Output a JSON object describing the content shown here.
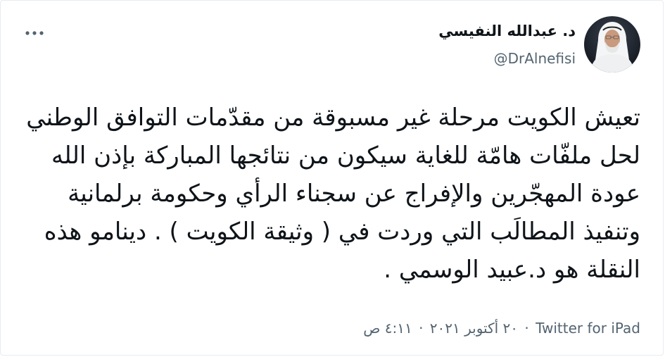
{
  "author": {
    "display_name": "د. عبدالله النفيسي",
    "handle": "@DrAlnefisi"
  },
  "tweet": {
    "text": "تعيش الكويت مرحلة غير مسبوقة من مقدّمات التوافق الوطني لحل ملفّات هامّة للغاية سيكون من نتائجها المباركة بإذن الله عودة المهجّرين والإفراج عن سجناء الرأي وحكومة برلمانية وتنفيذ المطالَب التي وردت في ( وثيقة الكويت ) . دينامو هذه النقلة هو د.عبيد الوسمي ."
  },
  "meta": {
    "time": "٤:١١ ص",
    "separator": "·",
    "date": "٢٠ أكتوبر ٢٠٢١",
    "source": "Twitter for iPad"
  },
  "icons": {
    "more": "more-horizontal-icon"
  }
}
